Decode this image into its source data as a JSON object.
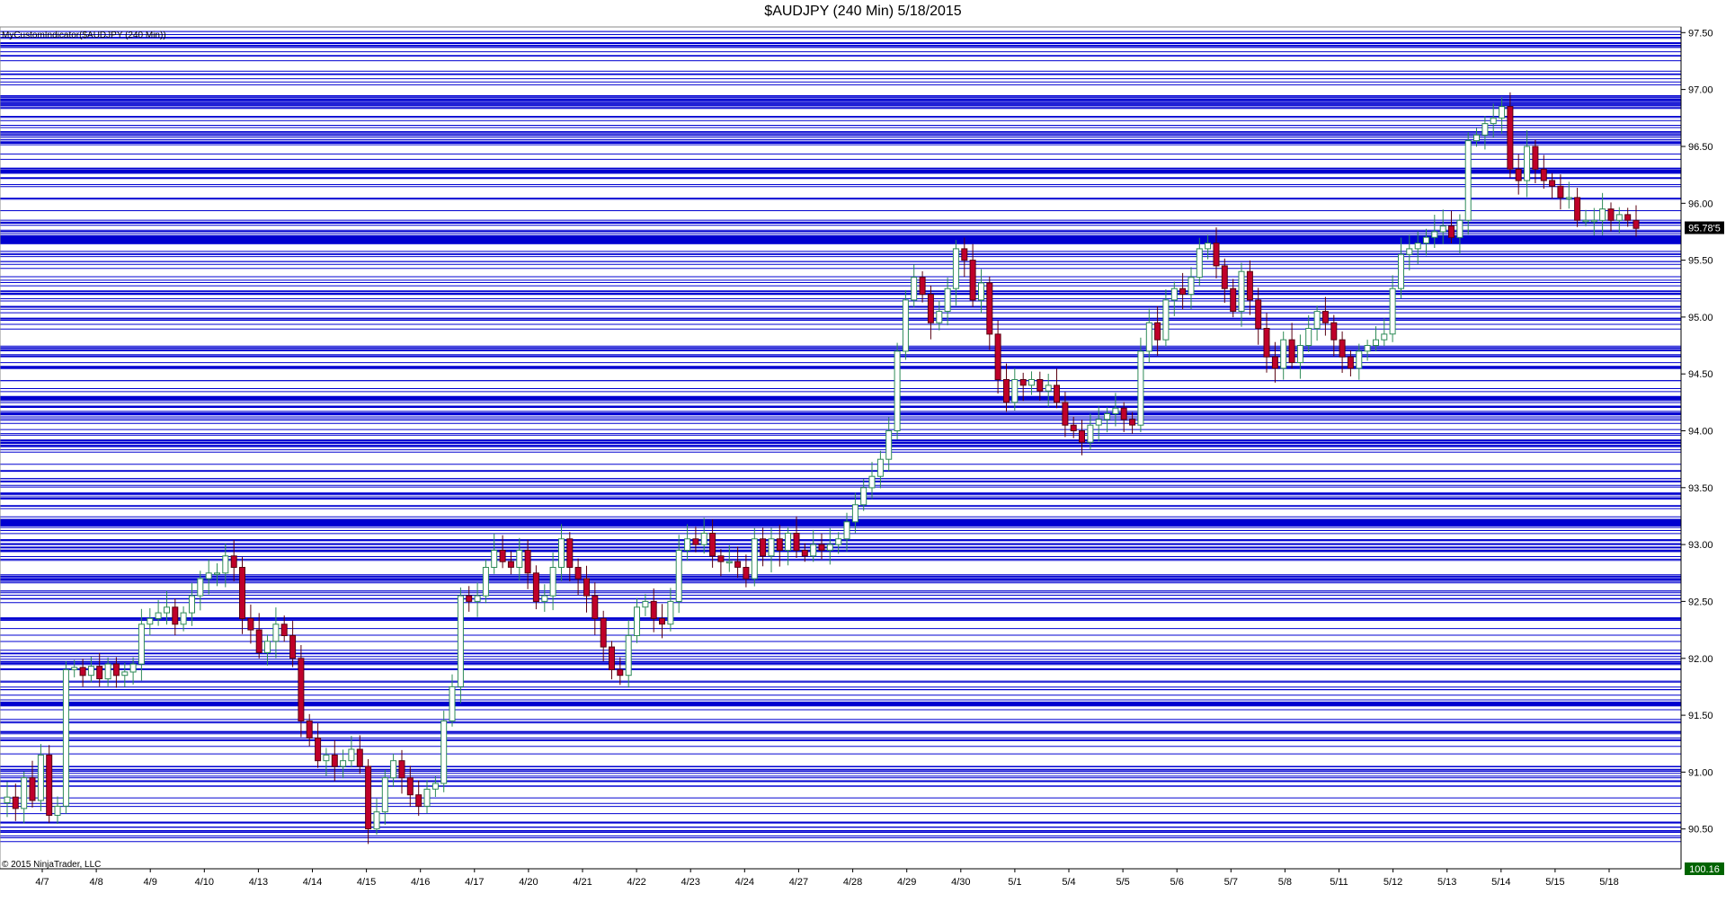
{
  "title": "$AUDJPY (240 Min)  5/18/2015",
  "indicator_label": "MyCustomIndicator($AUDJPY (240 Min))",
  "copyright": "© 2015 NinjaTrader, LLC",
  "price_marker": "95.78'5",
  "scale_marker": "100.16",
  "colors": {
    "up_body": "#ffffff",
    "down_body": "#c0002a",
    "up_wick": "#2e8b57",
    "down_wick": "#5a0010",
    "grid_line": "#0000d0",
    "marker_bg": "#000000",
    "scale_marker_bg": "#006400"
  },
  "chart_data": {
    "type": "candlestick",
    "ylim": [
      90.15,
      97.55
    ],
    "y_ticks": [
      "90.50",
      "91.00",
      "91.50",
      "92.00",
      "92.50",
      "93.00",
      "93.50",
      "94.00",
      "94.50",
      "95.00",
      "95.50",
      "96.00",
      "96.50",
      "97.00",
      "97.50"
    ],
    "x_labels": [
      "4/7",
      "4/8",
      "4/9",
      "4/10",
      "4/13",
      "4/14",
      "4/15",
      "4/16",
      "4/17",
      "4/20",
      "4/21",
      "4/22",
      "4/23",
      "4/24",
      "4/27",
      "4/28",
      "4/29",
      "4/30",
      "5/1",
      "5/4",
      "5/5",
      "5/6",
      "5/7",
      "5/8",
      "5/11",
      "5/12",
      "5/13",
      "5/14",
      "5/15",
      "5/18"
    ],
    "last_price": 95.785,
    "closes": [
      90.78,
      90.68,
      90.95,
      90.75,
      91.15,
      90.62,
      90.7,
      91.9,
      91.92,
      91.85,
      91.93,
      91.82,
      91.95,
      91.85,
      91.88,
      91.95,
      92.3,
      92.35,
      92.4,
      92.45,
      92.3,
      92.4,
      92.55,
      92.7,
      92.75,
      92.75,
      92.9,
      92.8,
      92.35,
      92.25,
      92.05,
      92.15,
      92.3,
      92.2,
      92.0,
      91.45,
      91.3,
      91.1,
      91.15,
      91.05,
      91.1,
      91.2,
      91.05,
      90.5,
      90.65,
      90.95,
      91.1,
      90.95,
      90.8,
      90.7,
      90.85,
      90.9,
      91.45,
      91.75,
      92.55,
      92.5,
      92.55,
      92.8,
      92.95,
      92.85,
      92.8,
      92.95,
      92.75,
      92.5,
      92.55,
      92.8,
      93.05,
      92.8,
      92.7,
      92.55,
      92.35,
      92.1,
      91.9,
      91.85,
      92.2,
      92.45,
      92.5,
      92.35,
      92.3,
      92.5,
      92.95,
      93.05,
      93.0,
      93.1,
      92.9,
      92.85,
      92.85,
      92.8,
      92.7,
      93.05,
      92.9,
      93.05,
      92.95,
      93.1,
      92.95,
      92.9,
      93.0,
      92.95,
      93.0,
      93.05,
      93.2,
      93.35,
      93.5,
      93.6,
      93.75,
      94.0,
      94.7,
      95.15,
      95.35,
      95.2,
      94.95,
      95.05,
      95.25,
      95.6,
      95.5,
      95.15,
      95.3,
      94.85,
      94.45,
      94.25,
      94.45,
      94.4,
      94.45,
      94.35,
      94.4,
      94.25,
      94.05,
      94.0,
      93.9,
      94.05,
      94.1,
      94.15,
      94.2,
      94.1,
      94.05,
      94.7,
      94.95,
      94.8,
      95.15,
      95.25,
      95.2,
      95.35,
      95.6,
      95.65,
      95.45,
      95.25,
      95.05,
      95.4,
      95.15,
      94.9,
      94.65,
      94.55,
      94.8,
      94.6,
      94.75,
      94.9,
      95.05,
      94.95,
      94.8,
      94.65,
      94.55,
      94.7,
      94.75,
      94.8,
      94.85,
      95.25,
      95.55,
      95.6,
      95.65,
      95.7,
      95.75,
      95.8,
      95.7,
      95.85,
      96.55,
      96.6,
      96.7,
      96.75,
      96.85,
      96.3,
      96.2,
      96.5,
      96.3,
      96.2,
      96.15,
      96.05,
      96.05,
      95.85,
      95.85,
      95.85,
      95.95,
      95.85,
      95.9,
      95.85,
      95.78
    ],
    "candle_count": 190,
    "note_labels": []
  }
}
